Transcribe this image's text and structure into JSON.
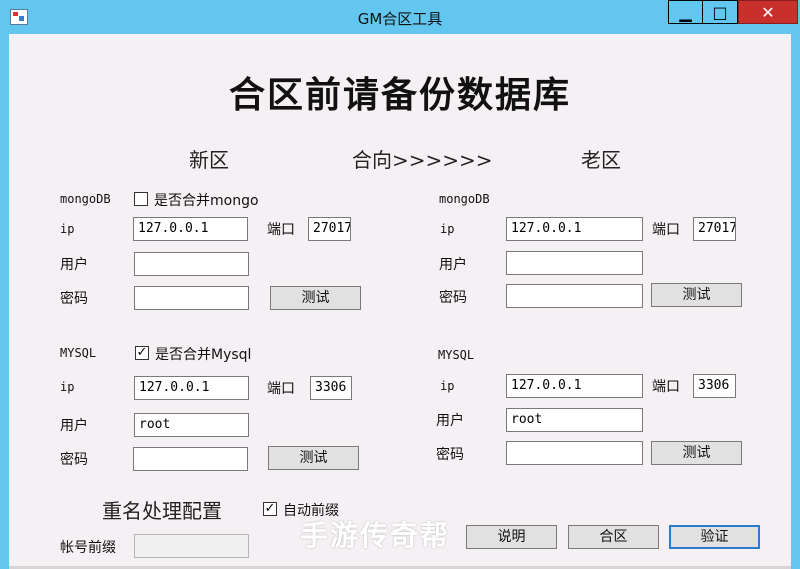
{
  "window": {
    "title": "GM合区工具",
    "minimize": "▁",
    "maximize": "□",
    "close": "✕"
  },
  "heading": "合区前请备份数据库",
  "sections": {
    "new": "新区",
    "direction": "合向>>>>>>",
    "old": "老区"
  },
  "new_server": {
    "mongo": {
      "label": "mongoDB",
      "merge_checkbox": {
        "label": "是否合并mongo",
        "checked": false,
        "mark": ""
      },
      "ip_label": "ip",
      "ip": "127.0.0.1",
      "port_label": "端口",
      "port": "27017",
      "user_label": "用户",
      "user": "",
      "password_label": "密码",
      "password": "",
      "test_button": "测试"
    },
    "mysql": {
      "label": "MYSQL",
      "merge_checkbox": {
        "label": "是否合并Mysql",
        "checked": true,
        "mark": "✓"
      },
      "ip_label": "ip",
      "ip": "127.0.0.1",
      "port_label": "端口",
      "port": "3306",
      "user_label": "用户",
      "user": "root",
      "password_label": "密码",
      "password": "",
      "test_button": "测试"
    }
  },
  "old_server": {
    "mongo": {
      "label": "mongoDB",
      "ip_label": "ip",
      "ip": "127.0.0.1",
      "port_label": "端口",
      "port": "27017",
      "user_label": "用户",
      "user": "",
      "password_label": "密码",
      "password": "",
      "test_button": "测试"
    },
    "mysql": {
      "label": "MYSQL",
      "ip_label": "ip",
      "ip": "127.0.0.1",
      "port_label": "端口",
      "port": "3306",
      "user_label": "用户",
      "user": "root",
      "password_label": "密码",
      "password": "",
      "test_button": "测试"
    }
  },
  "rename": {
    "title": "重名处理配置",
    "auto_prefix": {
      "label": "自动前缀",
      "checked": true,
      "mark": "✓"
    },
    "account_prefix_label": "帐号前缀",
    "account_prefix": ""
  },
  "actions": {
    "help": "说明",
    "merge": "合区",
    "verify": "验证"
  },
  "watermark": "手游传奇帮"
}
